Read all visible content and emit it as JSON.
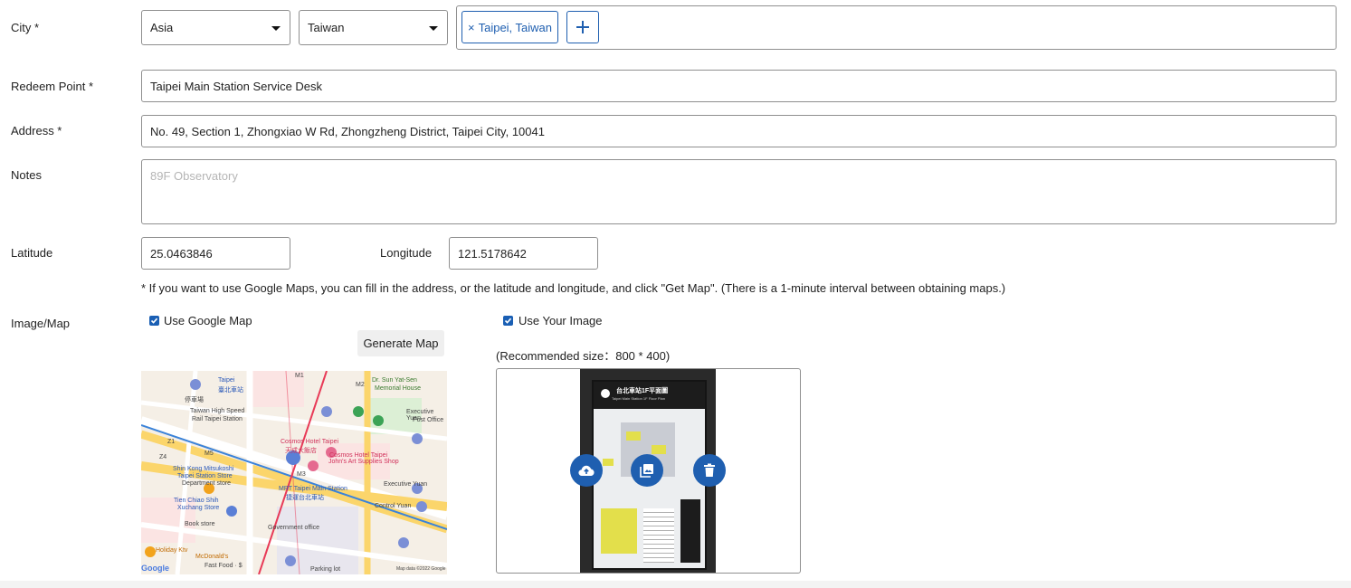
{
  "form": {
    "city": {
      "label": "City *",
      "continent": "Asia",
      "country": "Taiwan",
      "chips": [
        {
          "label": "Taipei, Taiwan"
        }
      ],
      "remove_glyph": "×",
      "add_icon": "plus-icon"
    },
    "redeem_point": {
      "label": "Redeem Point *",
      "value": "Taipei Main Station Service Desk"
    },
    "address": {
      "label": "Address *",
      "value": "No. 49, Section 1, Zhongxiao W Rd, Zhongzheng District, Taipei City, 10041"
    },
    "notes": {
      "label": "Notes",
      "value": "",
      "placeholder": "89F Observatory"
    },
    "latitude": {
      "label": "Latitude",
      "value": "25.0463846"
    },
    "longitude": {
      "label": "Longitude",
      "value": "121.5178642"
    },
    "hint": "* If you want to use Google Maps, you can fill in the address, or the latitude and longitude, and click \"Get Map\". (There is a 1-minute interval between obtaining maps.)",
    "image_map": {
      "label": "Image/Map",
      "use_google_map": {
        "label": "Use Google Map",
        "checked": true
      },
      "generate_map_label": "Generate Map",
      "use_your_image": {
        "label": "Use Your Image",
        "checked": true
      },
      "recommended": "(Recommended size：800 * 400)",
      "map_labels": {
        "m1": "M1",
        "m2": "M2",
        "m3": "M3",
        "m5": "M5",
        "z1": "Z1",
        "z4": "Z4",
        "taipei": "Taipei",
        "taipei_zh": "臺北車站",
        "station_zh": "停車場",
        "sun": "Dr. Sun Yat-Sen",
        "sun2": "Memorial House",
        "hsr1": "Taiwan High Speed",
        "hsr2": "Rail Taipei Station",
        "exec1": "Executive Yuan",
        "exec2": "Post Office",
        "cosmos": "Cosmos Hotel Taipei",
        "cosmos_zh": "天成大飯店",
        "cosmos2": "Cosmos Hotel Taipei",
        "art1": "John's Art Supplies Shop",
        "shin1": "Shin Kong Mitsukoshi",
        "shin2": "Taipei Station Store",
        "dept": "Department store",
        "mrt1": "MRT Taipei Main Station",
        "mrt_zh": "捷運台北車站",
        "execy": "Executive Yuan",
        "tien1": "Tien Chiao Shih",
        "tien2": "Xuchang Store",
        "tien3": "Book store",
        "control": "Control Yuan",
        "holiday": "Holiday Ktv",
        "mcd": "McDonald's",
        "fastfood": "Fast Food · $",
        "gov": "Government office",
        "google": "Google",
        "copyright": "Map data ©2022 Google",
        "parking": "Parking lot"
      },
      "actions": {
        "upload_icon": "cloud-upload-icon",
        "gallery_icon": "image-gallery-icon",
        "delete_icon": "trash-icon"
      },
      "board": {
        "title": "台北車站1F平面圖",
        "subtitle": "Taipei Main Station 1F Floor Plan"
      }
    }
  },
  "colors": {
    "accent": "#1f5fb0",
    "checkbox": "#1a5fb4",
    "border": "#8f8f8f"
  }
}
